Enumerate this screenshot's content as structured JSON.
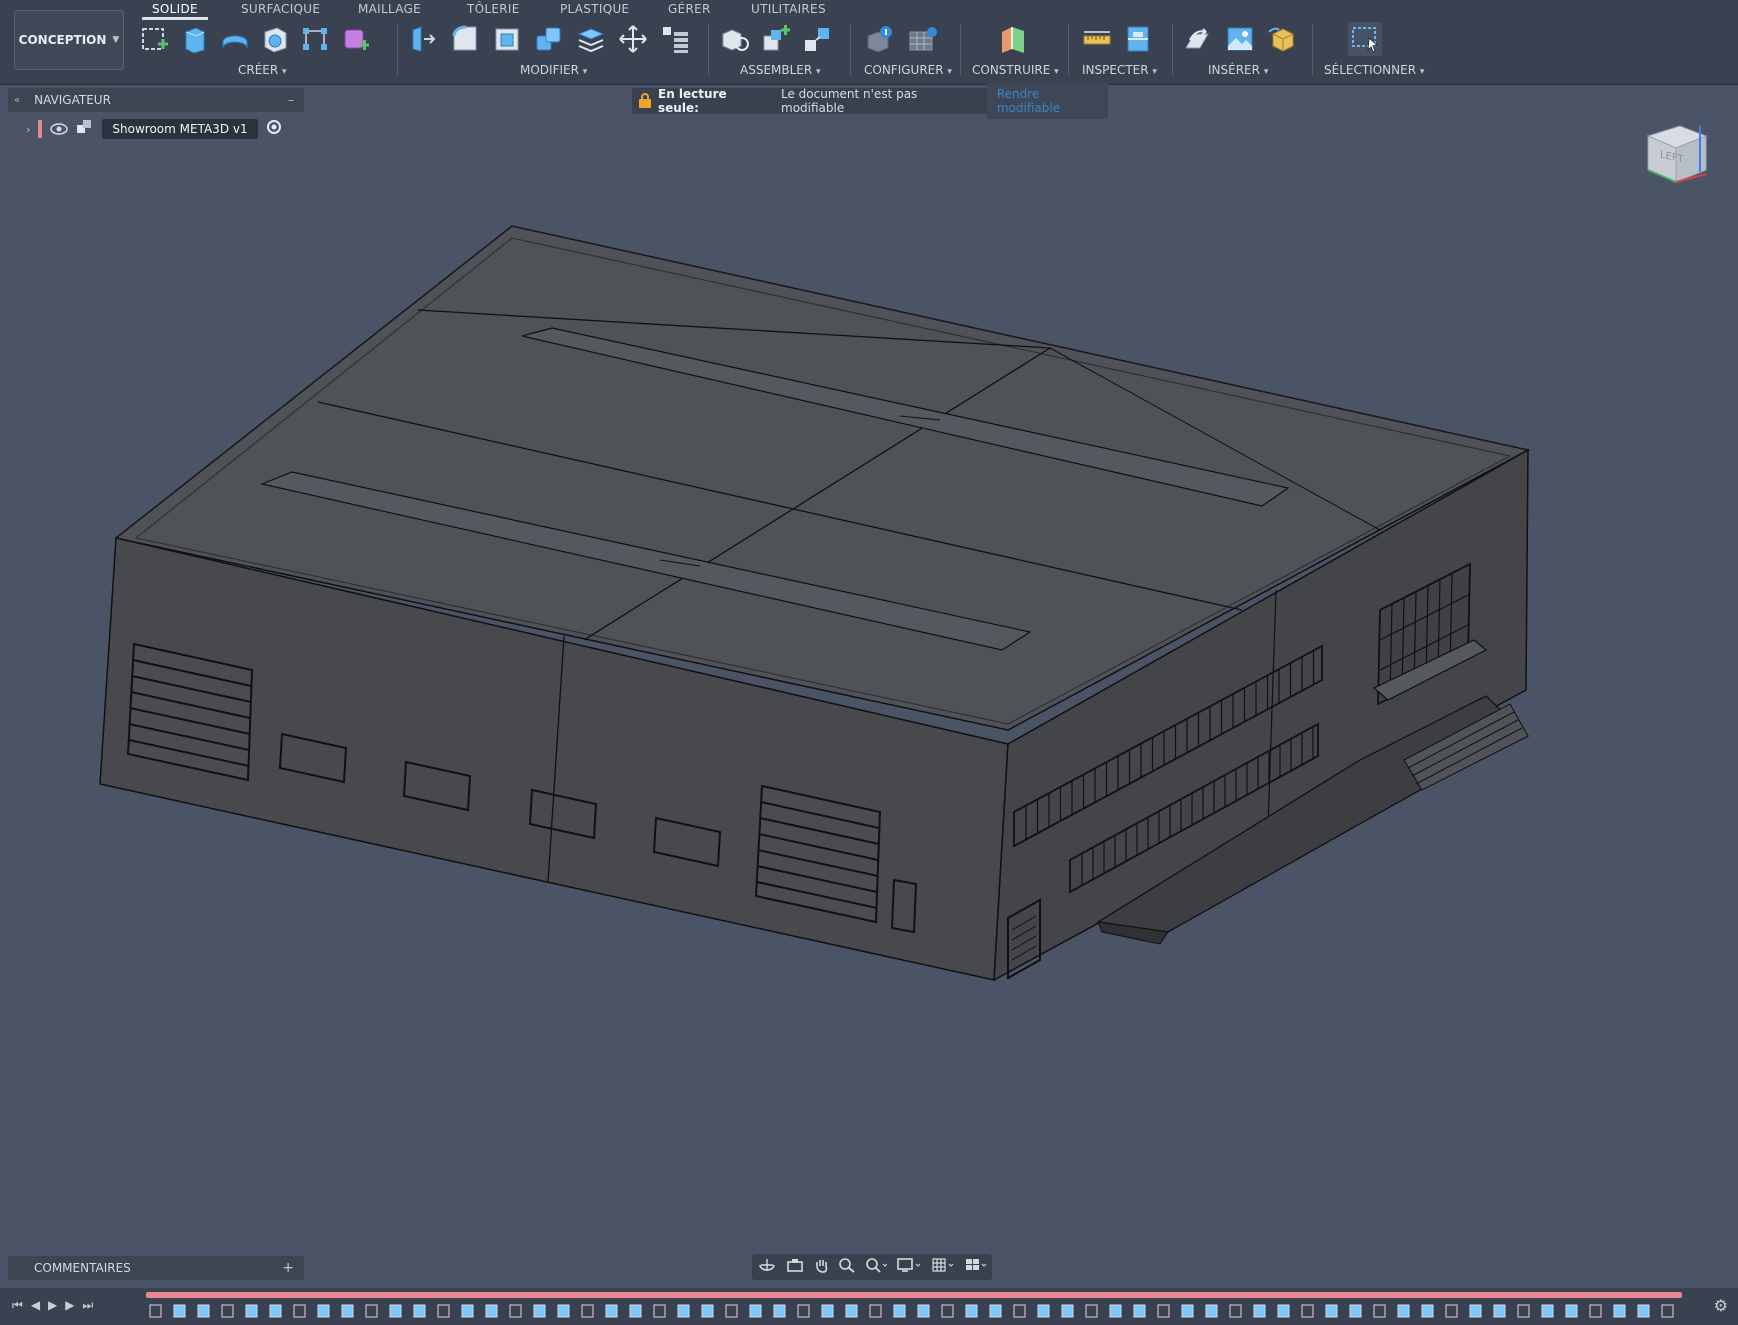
{
  "workspace": {
    "label": "CONCEPTION"
  },
  "tabs": [
    {
      "label": "SOLIDE",
      "active": true
    },
    {
      "label": "SURFACIQUE"
    },
    {
      "label": "MAILLAGE"
    },
    {
      "label": "TÔLERIE"
    },
    {
      "label": "PLASTIQUE"
    },
    {
      "label": "GÉRER"
    },
    {
      "label": "UTILITAIRES"
    }
  ],
  "groups": [
    {
      "label": "CRÉER",
      "tools": [
        "sketch-icon",
        "extrude-icon",
        "revolve-icon",
        "hole-icon",
        "pattern-icon",
        "create-form-icon"
      ]
    },
    {
      "label": "MODIFIER",
      "tools": [
        "press-pull-icon",
        "fillet-icon",
        "shell-icon",
        "combine-icon",
        "offset-face-icon",
        "move-icon",
        "align-icon"
      ]
    },
    {
      "label": "ASSEMBLER",
      "tools": [
        "joint-icon",
        "new-component-icon",
        "rigid-group-icon"
      ]
    },
    {
      "label": "CONFIGURER",
      "tools": [
        "configure-icon",
        "table-icon"
      ]
    },
    {
      "label": "CONSTRUIRE",
      "tools": [
        "plane-icon"
      ]
    },
    {
      "label": "INSPECTER",
      "tools": [
        "measure-icon",
        "section-icon"
      ]
    },
    {
      "label": "INSÉRER",
      "tools": [
        "insert-derive-icon",
        "decal-icon",
        "insert-mesh-icon"
      ]
    },
    {
      "label": "SÉLECTIONNER",
      "tools": [
        "select-icon"
      ]
    }
  ],
  "navigator": {
    "title": "NAVIGATEUR",
    "document": "Showroom META3D v1"
  },
  "notice": {
    "title": "En lecture seule:",
    "message": "Le document n'est pas modifiable",
    "link": "Rendre modifiable"
  },
  "viewcube": {
    "face": "LEFT"
  },
  "comments": {
    "title": "COMMENTAIRES"
  },
  "colors": {
    "background": "#4b5466",
    "toolbar": "#3a4150",
    "timeline_accent": "#e8898f",
    "model_fill": "#4a4d52"
  }
}
